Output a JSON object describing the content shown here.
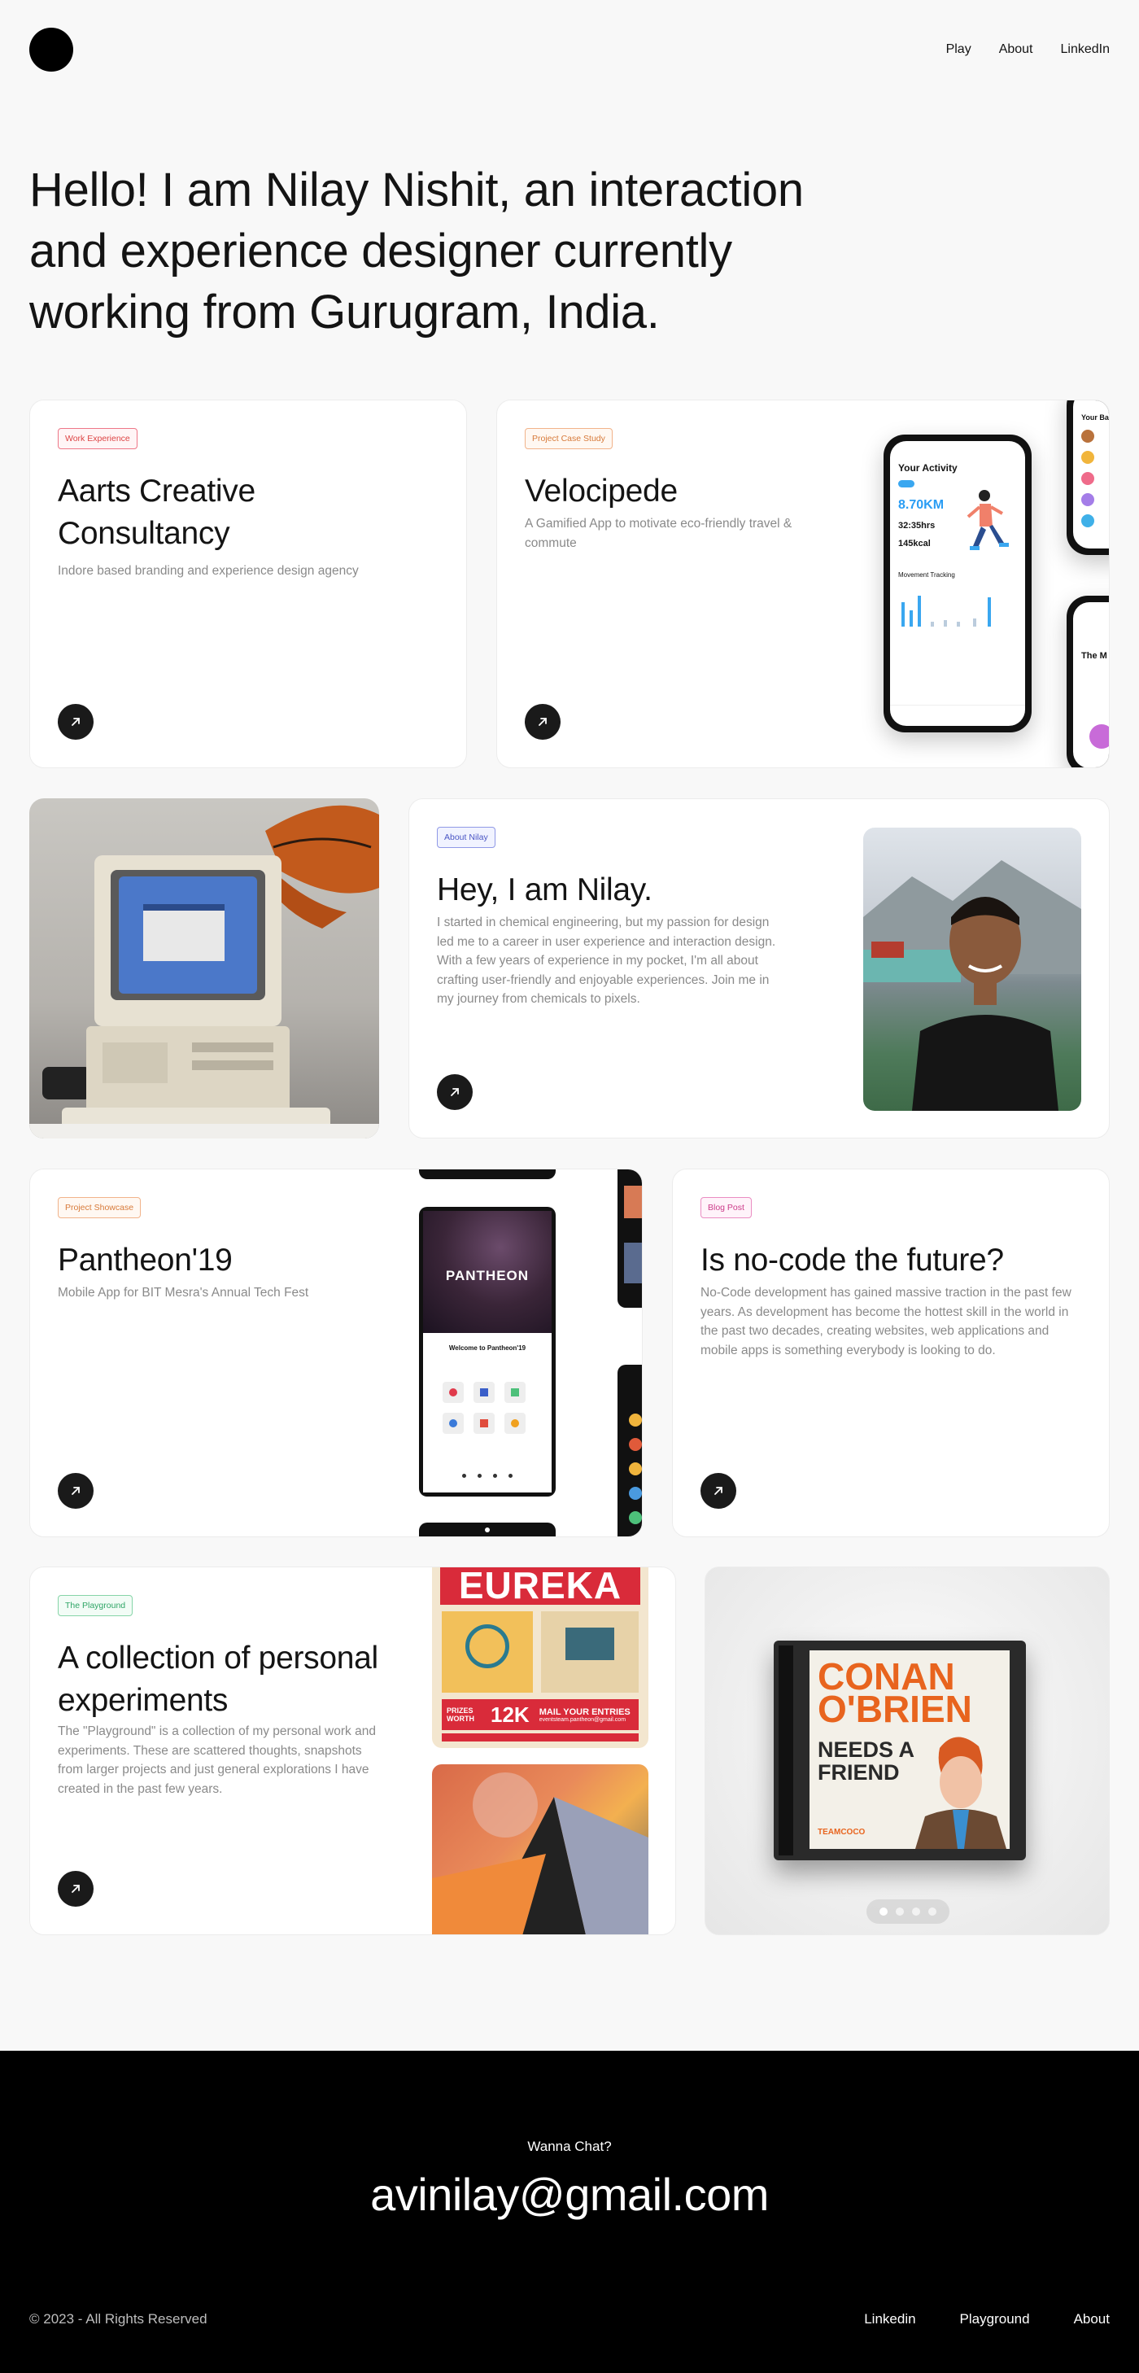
{
  "header": {
    "nav": [
      "Play",
      "About",
      "LinkedIn"
    ]
  },
  "hero": {
    "text": "Hello! I am Nilay Nishit, an interaction and experience designer currently working from Gurugram, India."
  },
  "cards": {
    "aarts": {
      "tag": "Work Experience",
      "title": "Aarts Creative Consultancy",
      "desc": "Indore based branding and experience design agency"
    },
    "velocipede": {
      "tag": "Project Case Study",
      "title": "Velocipede",
      "desc": "A Gamified App to motivate eco-friendly travel & commute",
      "phone": {
        "heading": "Your Activity",
        "distance": "8.70KM",
        "time": "32:35hrs",
        "calories": "145kcal",
        "chart_label": "Movement Tracking",
        "side_heading": "Your Ba",
        "side_heading2": "The M"
      }
    },
    "about": {
      "tag": "About Nilay",
      "title": "Hey, I am Nilay.",
      "desc": "I started in chemical engineering, but my passion for design led me to a career in user experience and interaction design. With a few years of experience in my pocket, I'm all about crafting user-friendly and enjoyable experiences. Join me in my journey from chemicals to pixels."
    },
    "pantheon": {
      "tag": "Project Showcase",
      "title": "Pantheon'19",
      "desc": "Mobile App for BIT Mesra's Annual Tech Fest",
      "phone": {
        "logo": "PANTHEON",
        "welcome": "Welcome to Pantheon'19"
      }
    },
    "nocode": {
      "tag": "Blog Post",
      "title": "Is no-code the future?",
      "desc": "No-Code development has gained massive traction in the past few years. As development has become the hottest skill in the world in the past two decades, creating websites, web applications and mobile apps is something everybody is looking to do."
    },
    "playground": {
      "tag": "The Playground",
      "title": "A collection of personal experiments",
      "desc": "The \"Playground\" is a collection of my personal work and experiments. These are scattered thoughts, snapshots from larger projects and just general explorations I have created in the past few years.",
      "poster": {
        "title": "EUREKA",
        "prizes": "PRIZES WORTH",
        "amount": "12K",
        "mail": "MAIL YOUR ENTRIES",
        "email": "eventsteam.pantheon@gmail.com"
      }
    },
    "conan": {
      "line1": "CONAN",
      "line2": "O'BRIEN",
      "line3": "NEEDS A",
      "line4": "FRIEND",
      "brand": "TEAMCOCO",
      "carousel_active": 1,
      "carousel_total": 4
    }
  },
  "footer": {
    "chat": "Wanna Chat?",
    "email": "avinilay@gmail.com",
    "copyright": "© 2023 - All Rights Reserved",
    "links": [
      "Linkedin",
      "Playground",
      "About"
    ]
  },
  "colors": {
    "background": "#f8f8f8",
    "ink": "#141414",
    "footer": "#000000"
  }
}
